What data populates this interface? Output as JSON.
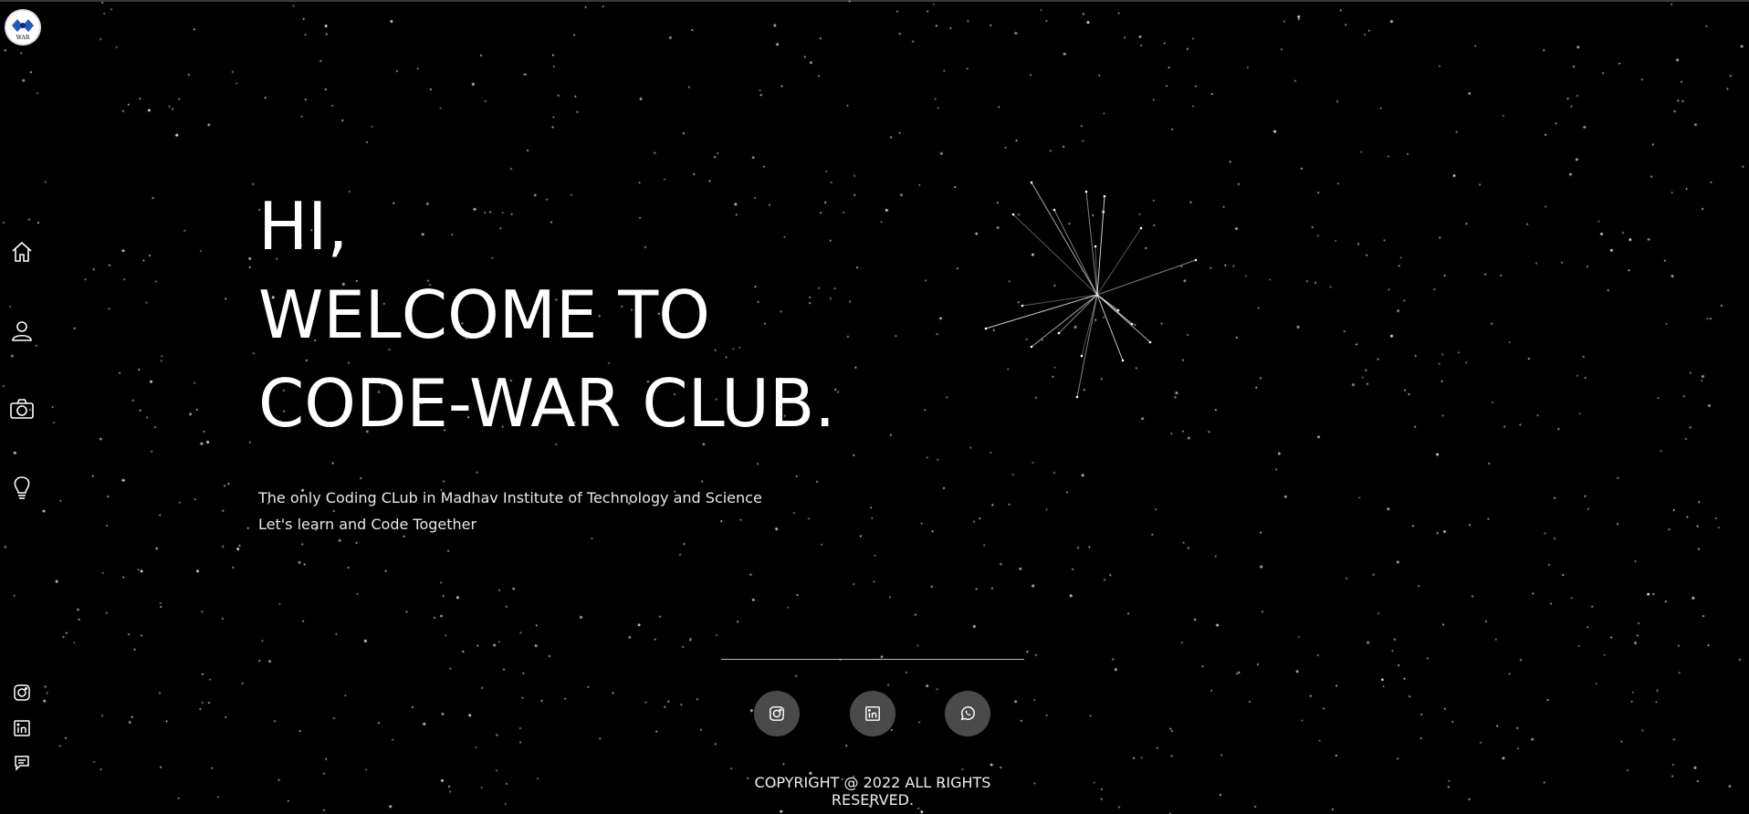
{
  "logo": {
    "text": "WAR"
  },
  "nav": [
    {
      "icon": "home-icon",
      "label": "Home"
    },
    {
      "icon": "user-icon",
      "label": "About"
    },
    {
      "icon": "camera-icon",
      "label": "Gallery"
    },
    {
      "icon": "lightbulb-icon",
      "label": "Ideas"
    }
  ],
  "hero": {
    "line1": "HI,",
    "line2": "WELCOME TO",
    "line3": "CODE-WAR CLUB.",
    "tagline1": "The only Coding CLub in Madhav Institute of Technology and Science",
    "tagline2": "Let's learn and Code Together"
  },
  "side_social": [
    "instagram-icon",
    "linkedin-icon",
    "chat-icon"
  ],
  "footer": {
    "social": [
      "instagram-icon",
      "linkedin-icon",
      "whatsapp-icon"
    ],
    "copyright": "COPYRIGHT @ 2022 ALL RIGHTS RESERVED."
  },
  "colors": {
    "background": "#000000",
    "text": "#ffffff",
    "button": "#4a4a4a"
  }
}
